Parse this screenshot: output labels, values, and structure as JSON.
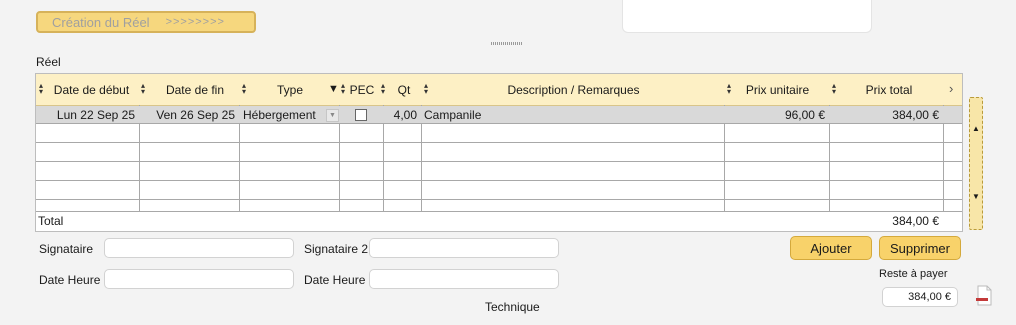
{
  "creation": {
    "label": "Création du Réel",
    "arrows": ">>>>>>>>"
  },
  "section_title": "Réel",
  "table": {
    "columns": [
      "Date de début",
      "Date de fin",
      "Type",
      "PEC",
      "Qt",
      "Description / Remarques",
      "Prix unitaire",
      "Prix total"
    ],
    "rows": [
      {
        "date_debut": "Lun 22 Sep 25",
        "date_fin": "Ven 26 Sep 25",
        "type": "Hébergement",
        "pec": false,
        "qt": "4,00",
        "description": "Campanile",
        "prix_unitaire": "96,00 €",
        "prix_total": "384,00 €"
      }
    ],
    "total_label": "Total",
    "total_value": "384,00 €"
  },
  "form": {
    "signataire_label": "Signataire",
    "signataire2_label": "Signataire 2",
    "date_heure_label": "Date Heure",
    "date_heure2_label": "Date Heure",
    "technique_label": "Technique"
  },
  "actions": {
    "add_label": "Ajouter",
    "delete_label": "Supprimer"
  },
  "reste": {
    "label": "Reste à payer",
    "value": "384,00 €"
  },
  "colors": {
    "accent": "#f8d26a",
    "header_bg": "#fdf0c5",
    "selected_row": "#d9d9d9"
  }
}
